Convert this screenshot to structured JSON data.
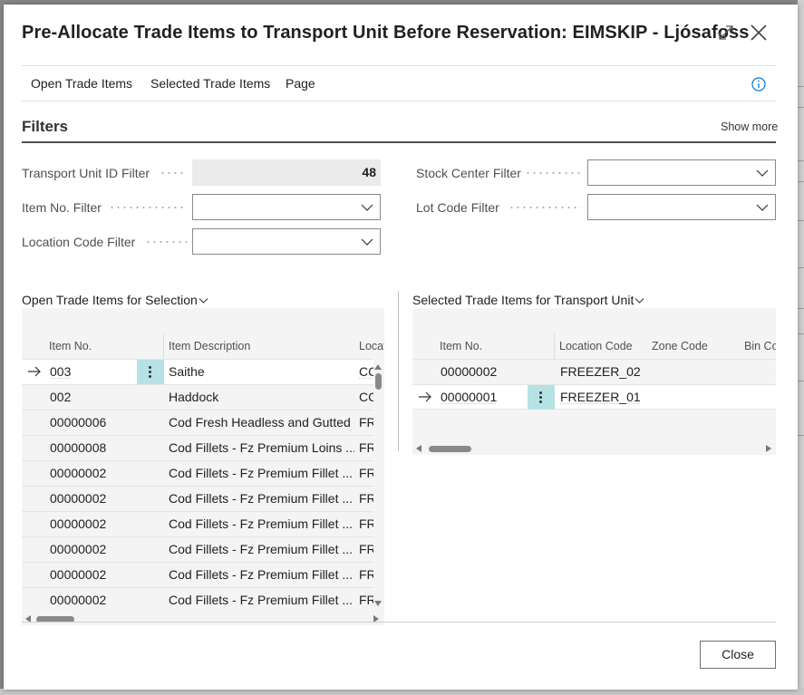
{
  "dialog": {
    "title": "Pre-Allocate Trade Items to Transport Unit Before Reservation: EIMSKIP - Ljósafoss"
  },
  "menu": {
    "items": [
      "Open Trade Items",
      "Selected Trade Items",
      "Page"
    ]
  },
  "filters": {
    "title": "Filters",
    "show_more": "Show more",
    "transport_unit_id": {
      "label": "Transport Unit ID Filter",
      "value": "48"
    },
    "item_no": {
      "label": "Item No. Filter",
      "value": ""
    },
    "location_code": {
      "label": "Location Code Filter",
      "value": ""
    },
    "stock_center": {
      "label": "Stock Center Filter",
      "value": ""
    },
    "lot_code": {
      "label": "Lot Code Filter",
      "value": ""
    }
  },
  "open_items": {
    "title": "Open Trade Items for Selection",
    "columns": [
      "Item No.",
      "Item Description",
      "Locat"
    ],
    "rows": [
      [
        "003",
        "Saithe",
        "CC"
      ],
      [
        "002",
        "Haddock",
        "CC"
      ],
      [
        "00000006",
        "Cod Fresh Headless and Gutted",
        "FR"
      ],
      [
        "00000008",
        "Cod Fillets - Fz Premium Loins ...",
        "FR"
      ],
      [
        "00000002",
        "Cod Fillets - Fz Premium Fillet ...",
        "FR"
      ],
      [
        "00000002",
        "Cod Fillets - Fz Premium Fillet ...",
        "FR"
      ],
      [
        "00000002",
        "Cod Fillets - Fz Premium Fillet ...",
        "FR"
      ],
      [
        "00000002",
        "Cod Fillets - Fz Premium Fillet ...",
        "FR"
      ],
      [
        "00000002",
        "Cod Fillets - Fz Premium Fillet ...",
        "FR"
      ],
      [
        "00000002",
        "Cod Fillets - Fz Premium Fillet ...",
        "FR"
      ]
    ]
  },
  "selected_items": {
    "title": "Selected Trade Items for Transport Unit",
    "columns": [
      "Item No.",
      "Location Code",
      "Zone Code",
      "Bin Co"
    ],
    "rows": [
      [
        "00000002",
        "FREEZER_02",
        "",
        ""
      ],
      [
        "00000001",
        "FREEZER_01",
        "",
        ""
      ]
    ]
  },
  "footer": {
    "close_label": "Close"
  },
  "colors": {
    "accent": "#0078d4",
    "row_menu": "#b6e2e6",
    "readonly": "#ebebeb"
  }
}
